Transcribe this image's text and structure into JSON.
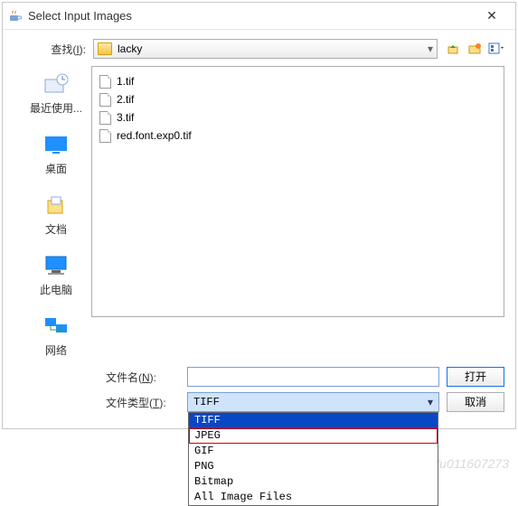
{
  "title": "Select Input Images",
  "lookin_label_pre": "查找(",
  "lookin_label_key": "I",
  "lookin_label_post": "):",
  "current_folder": "lacky",
  "places": {
    "recent": "最近使用...",
    "desktop": "桌面",
    "documents": "文档",
    "thispc": "此电脑",
    "network": "网络"
  },
  "files": [
    "1.tif",
    "2.tif",
    "3.tif",
    "red.font.exp0.tif"
  ],
  "filename_label_pre": "文件名(",
  "filename_label_key": "N",
  "filename_label_post": "):",
  "filename_value": "",
  "filetype_label_pre": "文件类型(",
  "filetype_label_key": "T",
  "filetype_label_post": "):",
  "filetype_selected": "TIFF",
  "filetype_options": {
    "o0": "TIFF",
    "o1": "JPEG",
    "o2": "GIF",
    "o3": "PNG",
    "o4": "Bitmap",
    "o5": "All Image Files"
  },
  "btn_open": "打开",
  "btn_cancel": "取消",
  "watermark": "https://blog.csdn.net/u011607273",
  "chart_data": null
}
